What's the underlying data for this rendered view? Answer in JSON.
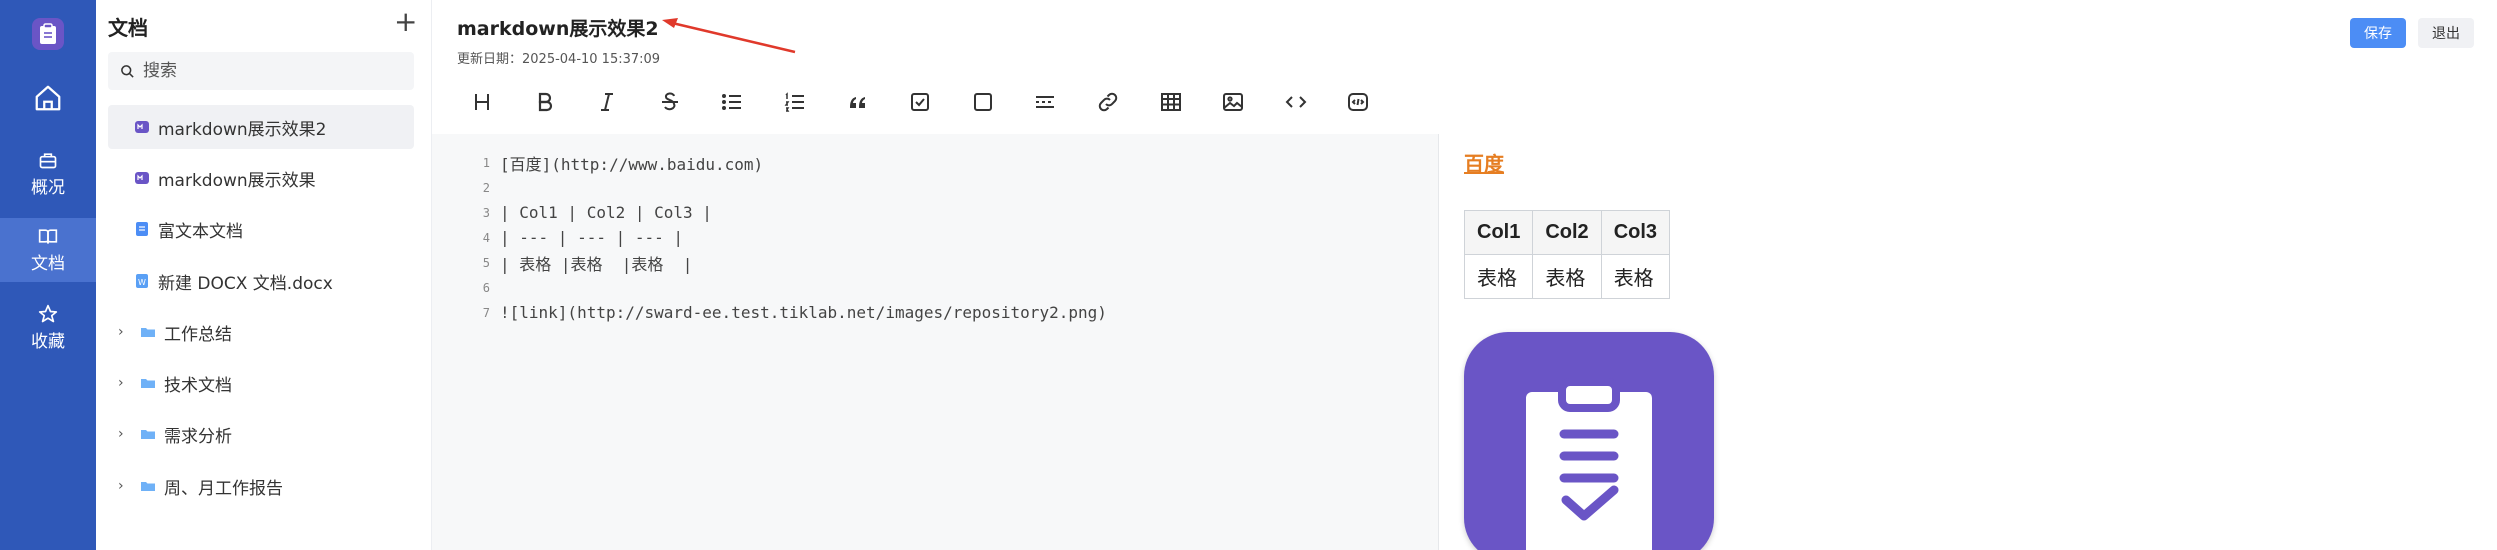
{
  "rail": {
    "items": [
      {
        "name": "home",
        "label": ""
      },
      {
        "name": "overview",
        "label": "概况"
      },
      {
        "name": "docs",
        "label": "文档"
      },
      {
        "name": "favorites",
        "label": "收藏"
      }
    ]
  },
  "tree": {
    "title": "文档",
    "add_icon": "plus-icon",
    "search_placeholder": "搜索",
    "items": [
      {
        "label": "markdown展示效果2",
        "type": "markdown",
        "selected": true
      },
      {
        "label": "markdown展示效果",
        "type": "markdown"
      },
      {
        "label": "富文本文档",
        "type": "richtext"
      },
      {
        "label": "新建 DOCX 文档.docx",
        "type": "docx"
      },
      {
        "label": "工作总结",
        "type": "folder"
      },
      {
        "label": "技术文档",
        "type": "folder"
      },
      {
        "label": "需求分析",
        "type": "folder"
      },
      {
        "label": "周、月工作报告",
        "type": "folder"
      }
    ]
  },
  "header": {
    "title": "markdown展示效果2",
    "date": "更新日期：2025-04-10 15:37:09",
    "save_label": "保存",
    "exit_label": "退出"
  },
  "toolbar": {
    "tools": [
      "heading-icon",
      "bold-icon",
      "italic-icon",
      "strikethrough-icon",
      "bullet-list-icon",
      "numbered-list-icon",
      "quote-icon",
      "checked-box-icon",
      "unchecked-box-icon",
      "divider-icon",
      "link-icon",
      "table-icon",
      "image-icon",
      "code-icon",
      "code-block-icon"
    ]
  },
  "editor": {
    "lines": [
      {
        "n": "1",
        "text": "[百度](http://www.baidu.com)"
      },
      {
        "n": "2",
        "text": ""
      },
      {
        "n": "3",
        "text": "| Col1 | Col2 | Col3 |"
      },
      {
        "n": "4",
        "text": "| --- | --- | --- |"
      },
      {
        "n": "5",
        "text": "| 表格 |表格  |表格  |"
      },
      {
        "n": "6",
        "text": ""
      },
      {
        "n": "7",
        "text": "![link](http://sward-ee.test.tiklab.net/images/repository2.png)"
      }
    ]
  },
  "preview": {
    "link_text": "百度",
    "table": {
      "headers": [
        "Col1",
        "Col2",
        "Col3"
      ],
      "rows": [
        [
          "表格",
          "表格",
          "表格"
        ]
      ]
    },
    "image_icon": "clipboard-check-icon"
  },
  "colors": {
    "rail_bg": "#2f58b8",
    "rail_active": "#4a72cf",
    "logo_purple": "#6a55c6",
    "save_blue": "#4c8df5",
    "link_orange": "#e67e22",
    "arrow_red": "#e0392b"
  }
}
